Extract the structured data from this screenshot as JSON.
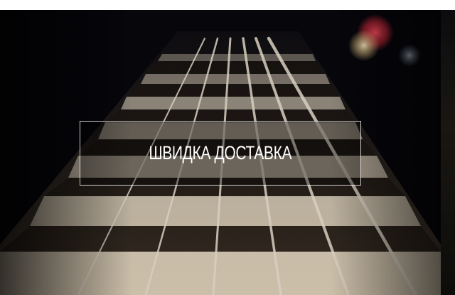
{
  "hero": {
    "background_icon": "guitar-fretboard-photo",
    "cta_label": "ШВИДКА ДОСТАВКА"
  },
  "colors": {
    "background": "#07070c",
    "wood": "#6b5a48",
    "fret": "#e8dcc6",
    "bokeh_red": "#c8283a",
    "text": "#ffffff"
  }
}
